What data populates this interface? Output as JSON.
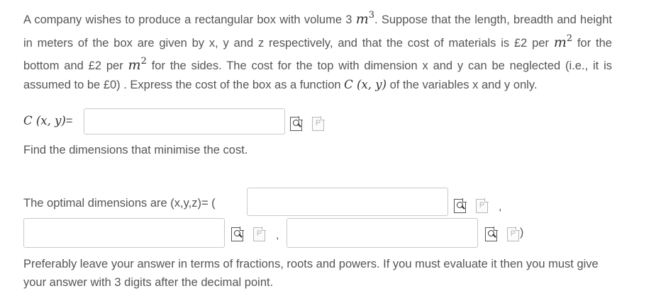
{
  "question": {
    "p1": "A company wishes to produce a rectangular box with volume 3 ",
    "unit_m": "m",
    "exp3": "3",
    "p2": ". Suppose that the length, breadth and height in meters of the box are given by x, y and z respectively, and that the cost of materials is £2 per ",
    "exp2a": "2",
    "p3": " for the bottom and £2 per ",
    "exp2b": "2",
    "p4": " for the sides. The cost for the top with dimension x and y can be neglected (i.e., it is assumed to be £0) . Express the cost of the box as a function ",
    "func": "C (x, y)",
    "p5": " of the variables x and y only."
  },
  "cost_field": {
    "label_math": "C (x, y)",
    "label_eq": "=",
    "value": ""
  },
  "find_text": "Find the dimensions that minimise the cost.",
  "optimal": {
    "label": "The optimal dimensions are (x,y,z)=  (",
    "comma1": ",",
    "comma2": ",",
    "close": ")",
    "x_value": "",
    "y_value": "",
    "z_value": ""
  },
  "note": "Preferably leave your answer in terms of fractions, roots and powers. If you must evaluate it then you must give your answer with 3 digits after the decimal point.",
  "icons": {
    "preview": "preview-magnifier-icon",
    "help": "equation-editor-p-icon",
    "help_letter": "P"
  }
}
